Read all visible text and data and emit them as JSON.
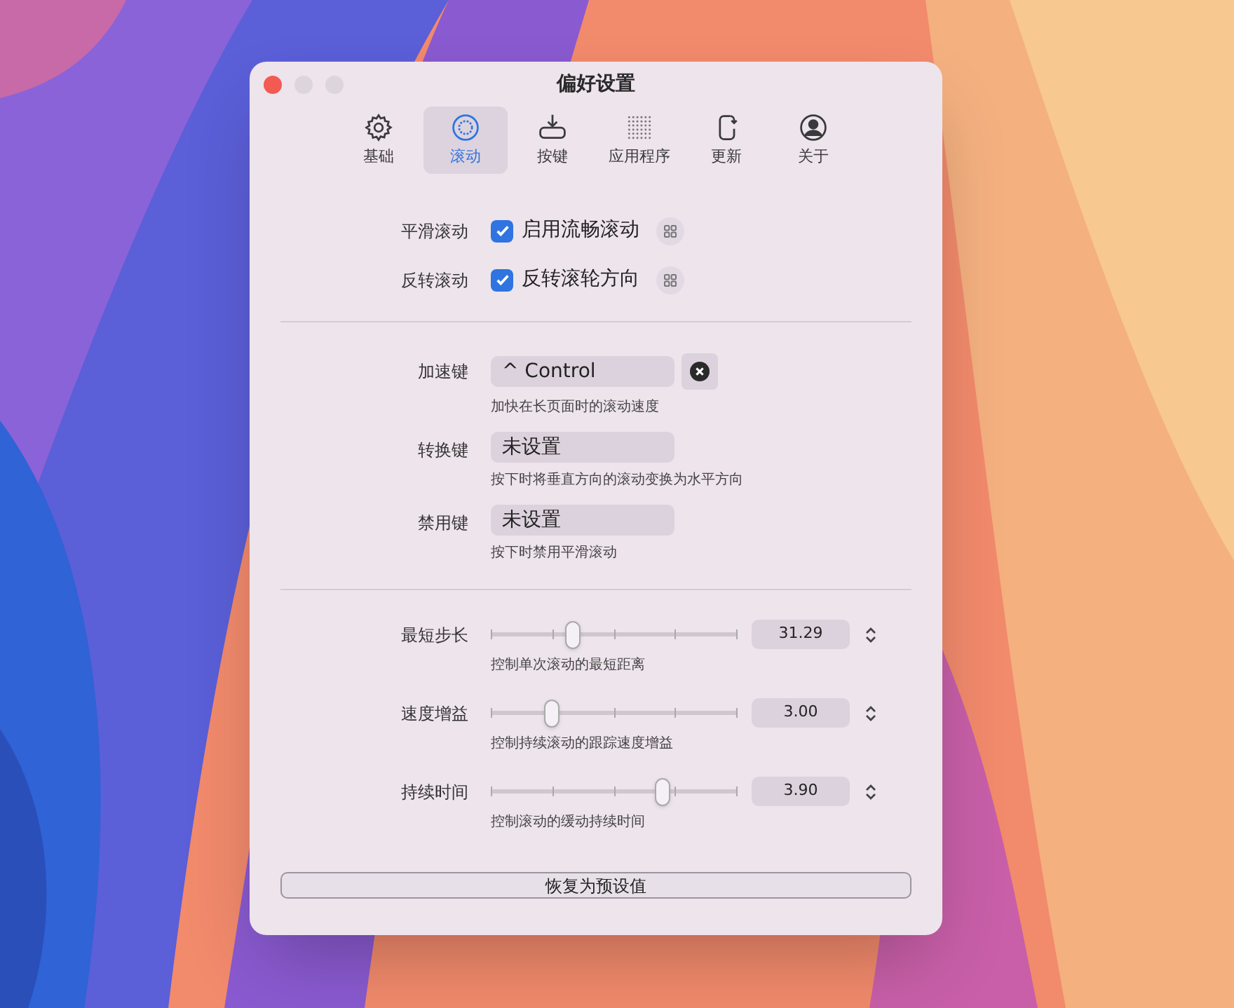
{
  "window": {
    "title": "偏好设置"
  },
  "tabs": [
    {
      "label": "基础",
      "kind": "gear",
      "selected": false
    },
    {
      "label": "滚动",
      "kind": "scroll",
      "selected": true
    },
    {
      "label": "按键",
      "kind": "keys",
      "selected": false
    },
    {
      "label": "应用程序",
      "kind": "grid",
      "selected": false
    },
    {
      "label": "更新",
      "kind": "update",
      "selected": false
    },
    {
      "label": "关于",
      "kind": "person",
      "selected": false
    }
  ],
  "toggles": [
    {
      "label": "平滑滚动",
      "text": "启用流畅滚动",
      "checked": true
    },
    {
      "label": "反转滚动",
      "text": "反转滚轮方向",
      "checked": true
    }
  ],
  "keys": [
    {
      "label": "加速键",
      "value": "^ Control",
      "clearable": true,
      "hint": "加快在长页面时的滚动速度"
    },
    {
      "label": "转换键",
      "value": "未设置",
      "clearable": false,
      "hint": "按下时将垂直方向的滚动变换为水平方向"
    },
    {
      "label": "禁用键",
      "value": "未设置",
      "clearable": false,
      "hint": "按下时禁用平滑滚动"
    }
  ],
  "sliders": [
    {
      "label": "最短步长",
      "level": 0.32,
      "value": "31.29",
      "hint": "控制单次滚动的最短距离"
    },
    {
      "label": "速度增益",
      "level": 0.23,
      "value": "3.00",
      "hint": "控制持续滚动的跟踪速度增益"
    },
    {
      "label": "持续时间",
      "level": 0.71,
      "value": "3.90",
      "hint": "控制滚动的缓动持续时间"
    }
  ],
  "reset_button": "恢复为预设值"
}
